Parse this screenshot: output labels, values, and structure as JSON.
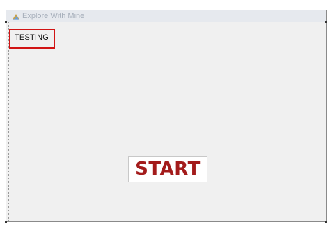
{
  "window": {
    "title": "Explore With Mine",
    "icon": "app-logo-icon"
  },
  "status": {
    "label": "TESTING",
    "border_color": "#d11414"
  },
  "start_button": {
    "label": "START",
    "text_color": "#a31b1b"
  }
}
